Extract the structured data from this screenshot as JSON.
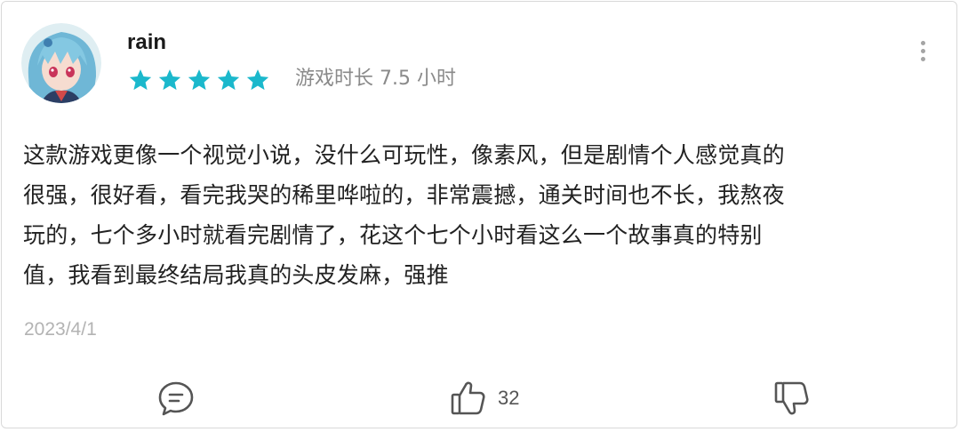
{
  "review": {
    "username": "rain",
    "rating": 5,
    "rating_max": 5,
    "playtime": "游戏时长 7.5 小时",
    "lines": [
      "这款游戏更像一个视觉小说，没什么可玩性，像素风，但是剧情个人感觉真的",
      "很强，很好看，看完我哭的稀里哗啦的，非常震撼，通关时间也不长，我熬夜",
      "玩的，七个多小时就看完剧情了，花这个七个小时看这么一个故事真的特别",
      "值，我看到最终结局我真的头皮发麻，强推"
    ],
    "date": "2023/4/1"
  },
  "actions": {
    "comment_icon": "comment-icon",
    "like_icon": "thumbs-up-icon",
    "like_count": "32",
    "dislike_icon": "thumbs-down-icon",
    "more_icon": "more-vertical-icon"
  },
  "colors": {
    "star": "#1bb8cc",
    "text": "#222222",
    "muted": "#8a8a8a",
    "date": "#b3b3b3"
  }
}
